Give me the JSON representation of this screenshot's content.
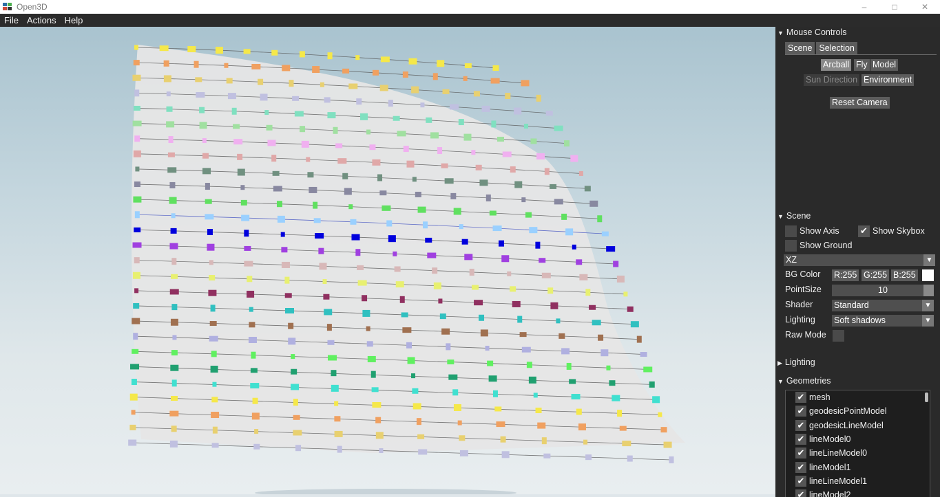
{
  "window": {
    "title": "Open3D",
    "minimize_icon": "minimize-icon",
    "maximize_icon": "restore-icon",
    "close_icon": "close-icon"
  },
  "menu": [
    "File",
    "Actions",
    "Help"
  ],
  "panel": {
    "mouse_controls": {
      "header": "Mouse Controls",
      "tabs": [
        "Scene",
        "Selection"
      ],
      "buttons": [
        "Arcball",
        "Fly",
        "Model",
        "Sun Direction",
        "Environment"
      ],
      "reset": "Reset Camera"
    },
    "scene": {
      "header": "Scene",
      "show_axis": "Show Axis",
      "show_skybox": "Show Skybox",
      "show_ground": "Show Ground",
      "plane": "XZ",
      "bg_color_label": "BG Color",
      "r": "R:255",
      "g": "G:255",
      "b": "B:255",
      "bg_swatch": "#ffffff",
      "pointsize_label": "PointSize",
      "pointsize_value": "10",
      "shader_label": "Shader",
      "shader_value": "Standard",
      "lighting_label": "Lighting",
      "lighting_value": "Soft shadows",
      "raw_mode_label": "Raw Mode"
    },
    "lighting": {
      "header": "Lighting"
    },
    "geometries": {
      "header": "Geometries",
      "items": [
        "mesh",
        "geodesicPointModel",
        "geodesicLineModel",
        "lineModel0",
        "lineLineModel0",
        "lineModel1",
        "lineLineModel1",
        "lineModel2"
      ]
    }
  }
}
